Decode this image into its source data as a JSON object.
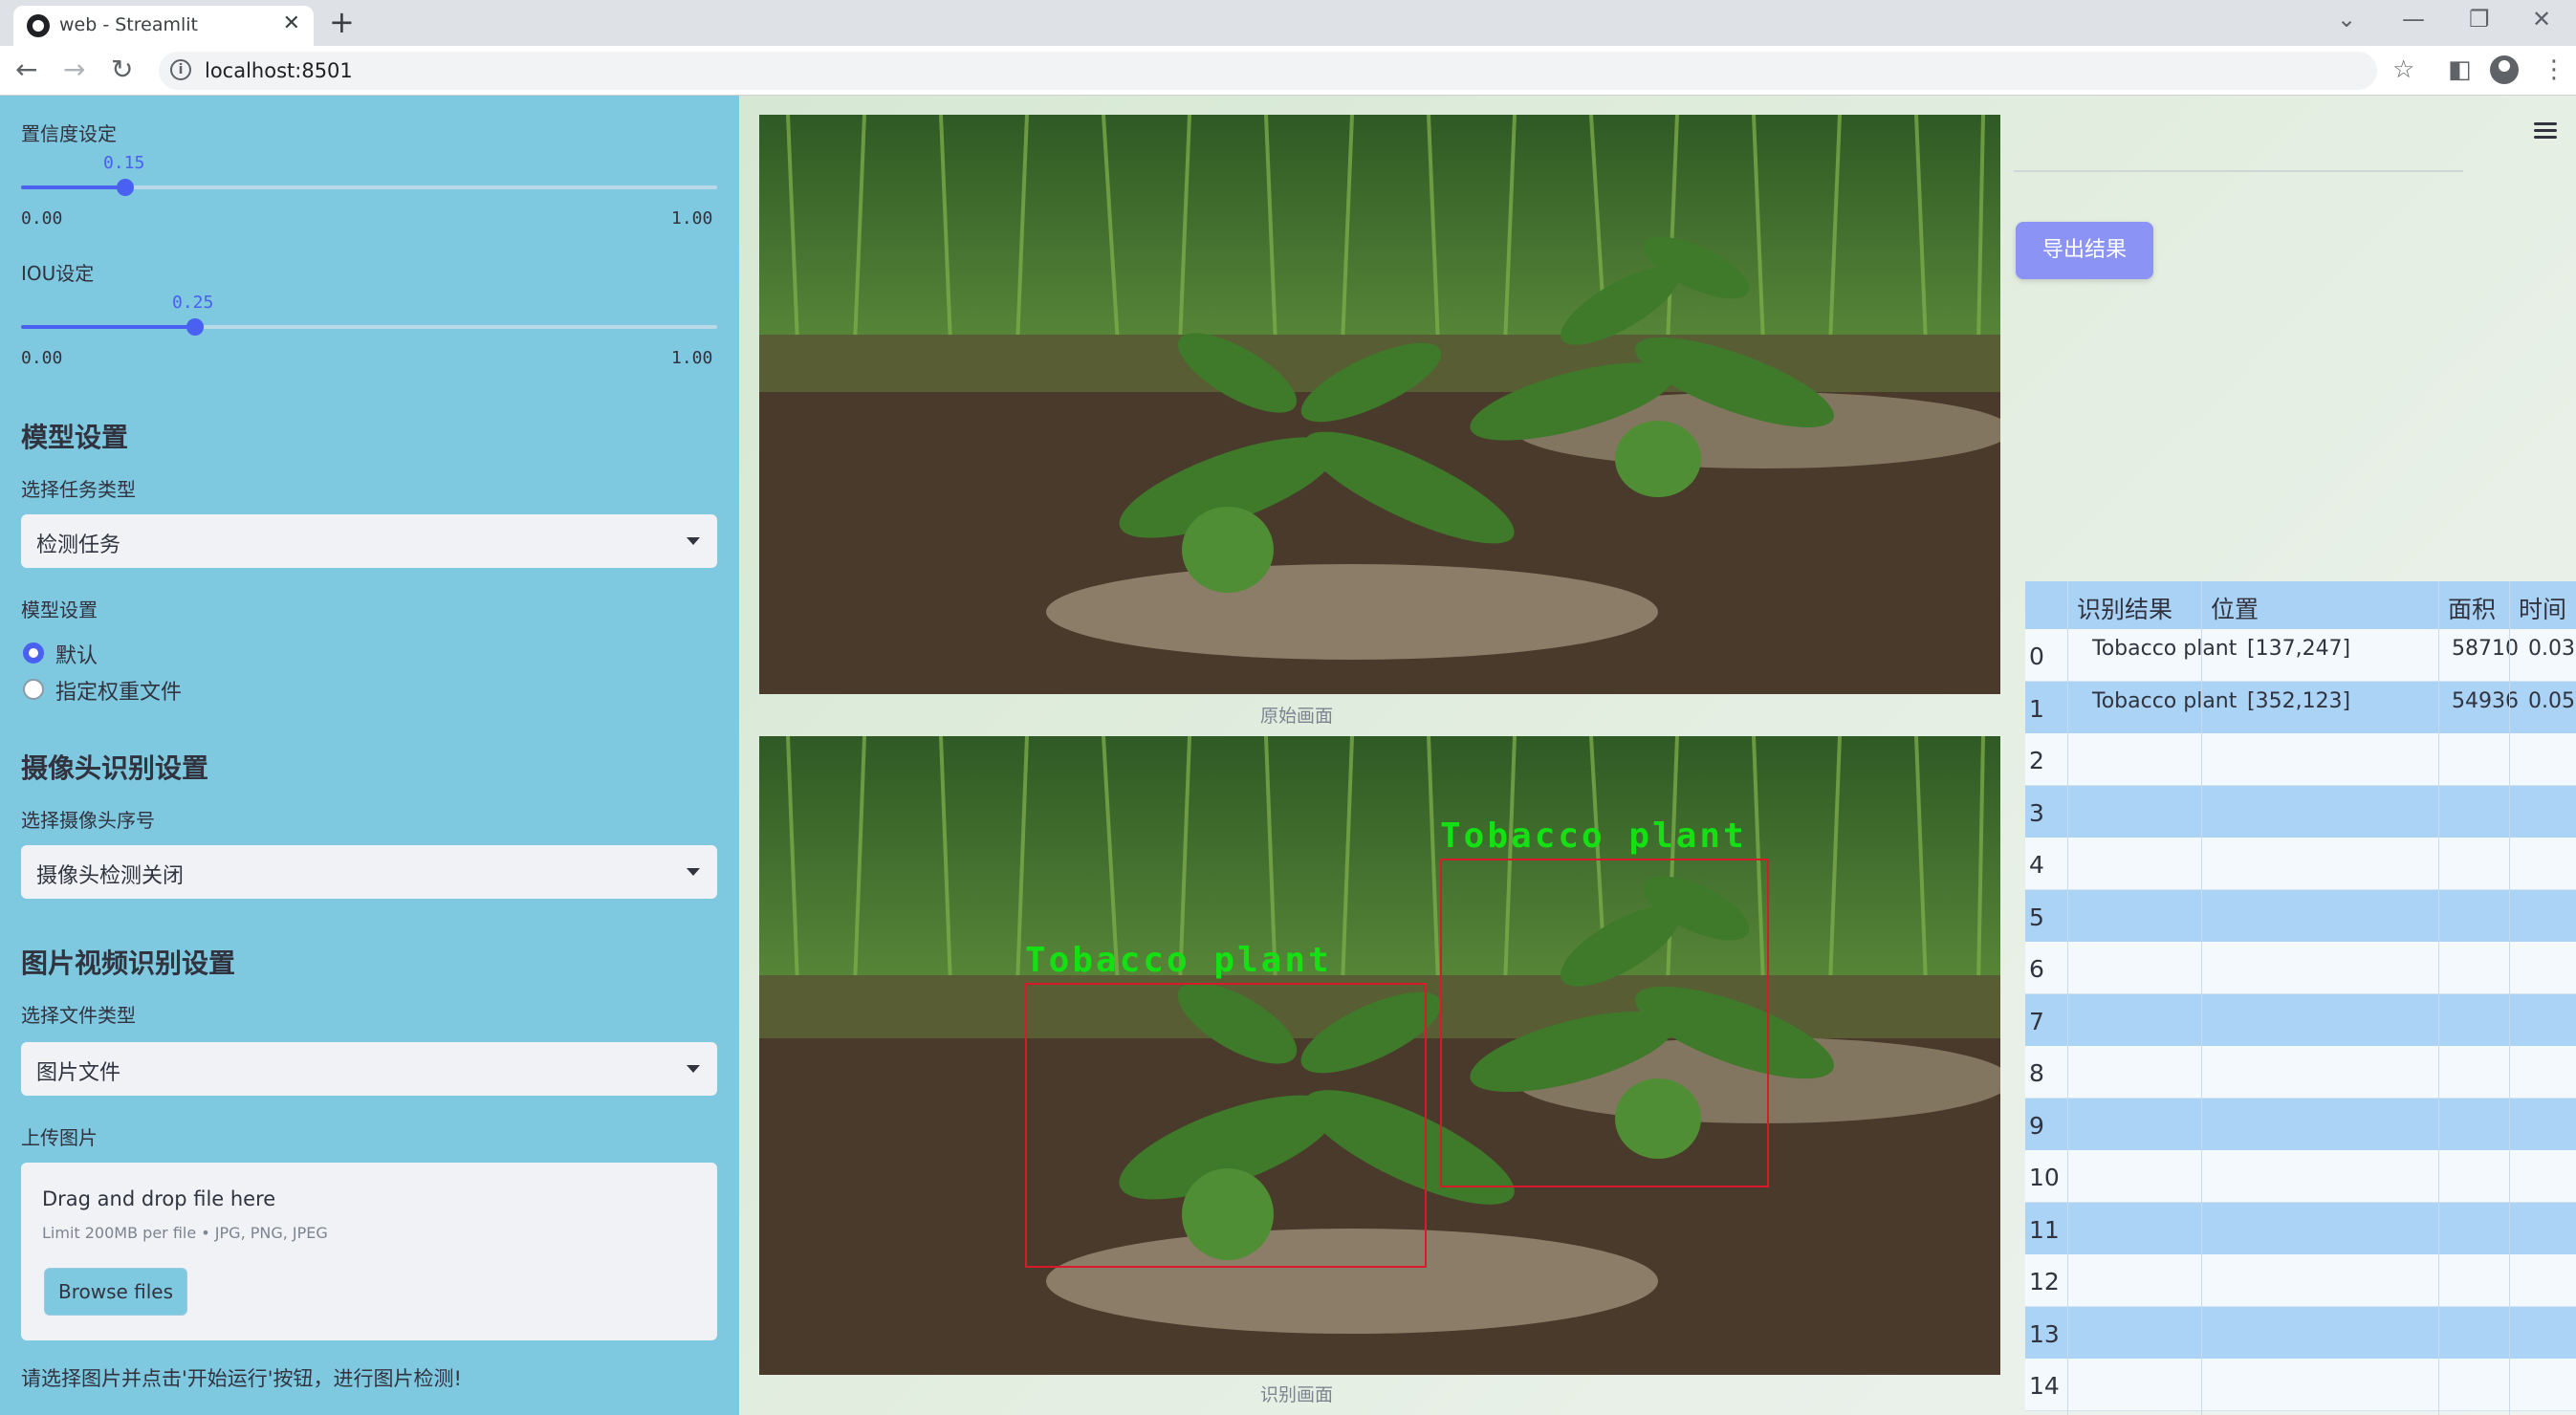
{
  "browser": {
    "tab_title": "web - Streamlit",
    "url": "localhost:8501"
  },
  "sidebar": {
    "confidence": {
      "label": "置信度设定",
      "value": "0.15",
      "min": "0.00",
      "max": "1.00",
      "fraction": 0.15
    },
    "iou": {
      "label": "IOU设定",
      "value": "0.25",
      "min": "0.00",
      "max": "1.00",
      "fraction": 0.25
    },
    "model_section": {
      "heading": "模型设置",
      "task_label": "选择任务类型",
      "task_value": "检测任务",
      "model_label": "模型设置",
      "options": [
        "默认",
        "指定权重文件"
      ],
      "selected": "默认"
    },
    "camera_section": {
      "heading": "摄像头识别设置",
      "camera_label": "选择摄像头序号",
      "camera_value": "摄像头检测关闭"
    },
    "media_section": {
      "heading": "图片视频识别设置",
      "filetype_label": "选择文件类型",
      "filetype_value": "图片文件",
      "upload_label": "上传图片",
      "dropzone_title": "Drag and drop file here",
      "dropzone_limit": "Limit 200MB per file • JPG, PNG, JPEG",
      "browse_button": "Browse files"
    },
    "note": "请选择图片并点击'开始运行'按钮，进行图片检测!"
  },
  "main": {
    "original_caption": "原始画面",
    "result_caption": "识别画面",
    "detections": [
      {
        "label": "Tobacco plant"
      },
      {
        "label": "Tobacco plant"
      }
    ],
    "export_button": "导出结果"
  },
  "results_table": {
    "headers": [
      "识别结果",
      "位置",
      "面积",
      "时间"
    ],
    "rows": [
      {
        "index": "0",
        "result": "Tobacco plant",
        "position": "[137,247]",
        "area": "58710",
        "time": "0.03"
      },
      {
        "index": "1",
        "result": "Tobacco plant",
        "position": "[352,123]",
        "area": "54936",
        "time": "0.05"
      },
      {
        "index": "2"
      },
      {
        "index": "3"
      },
      {
        "index": "4"
      },
      {
        "index": "5"
      },
      {
        "index": "6"
      },
      {
        "index": "7"
      },
      {
        "index": "8"
      },
      {
        "index": "9"
      },
      {
        "index": "10"
      },
      {
        "index": "11"
      },
      {
        "index": "12"
      },
      {
        "index": "13"
      },
      {
        "index": "14"
      }
    ]
  },
  "colors": {
    "sidebar_bg": "#7ec8e0",
    "accent": "#4a60f0",
    "export_button": "#8b93f4",
    "box_color": "#d81b2a",
    "label_color": "#14e014",
    "table_row_alt": "#aad3f6"
  }
}
